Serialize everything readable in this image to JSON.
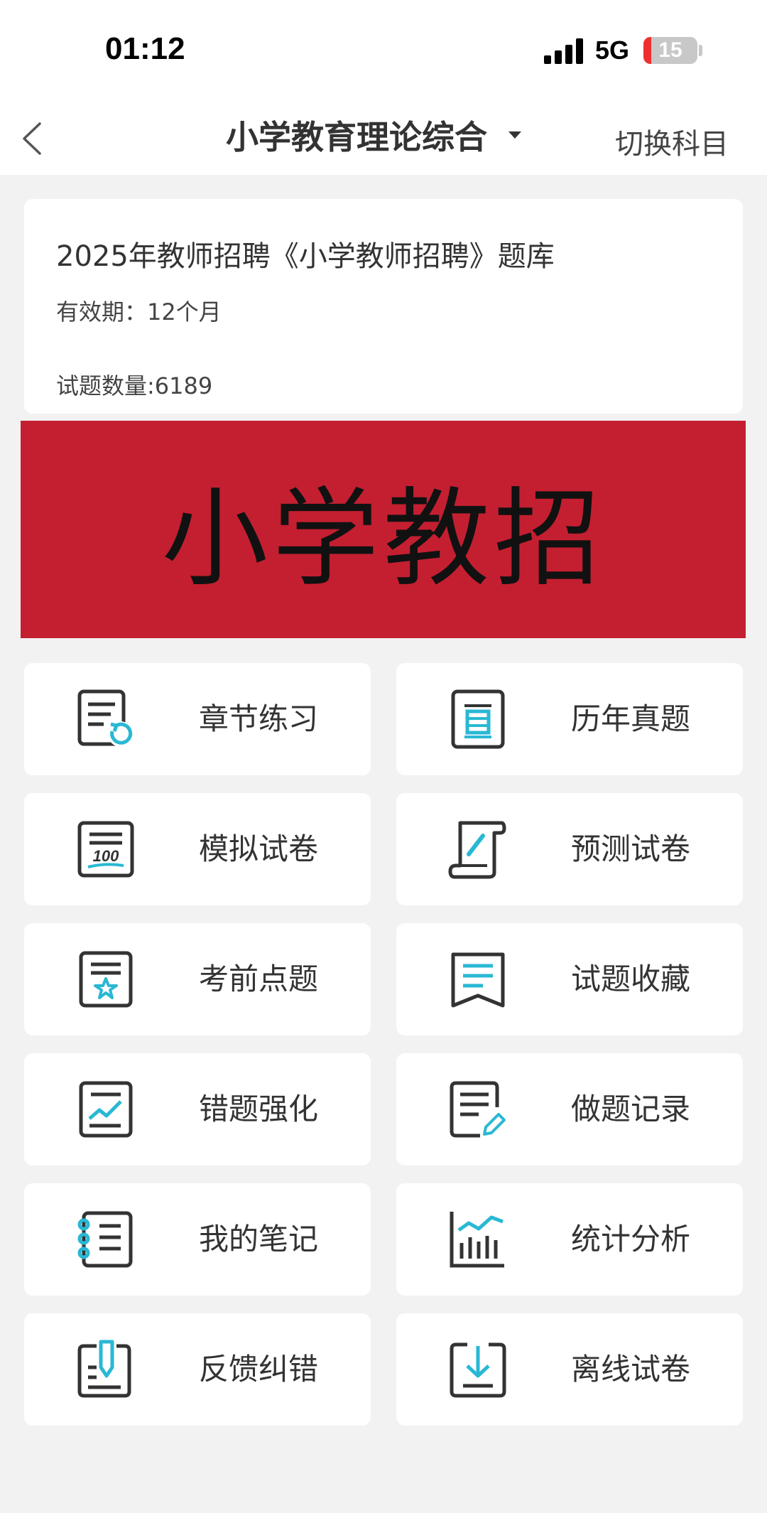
{
  "status_bar": {
    "time": "01:12",
    "network": "5G",
    "battery": "15",
    "battery_level_percent": 15
  },
  "nav": {
    "title": "小学教育理论综合",
    "switch_label": "切换科目"
  },
  "info_card": {
    "title": "2025年教师招聘《小学教师招聘》题库",
    "validity": "有效期：12个月",
    "question_count": "试题数量:6189"
  },
  "banner": {
    "text": "小学教招",
    "background": "#c41f31"
  },
  "accent_color": "#29b8d4",
  "menu": [
    {
      "label": "章节练习",
      "icon": "chapter-practice-icon"
    },
    {
      "label": "历年真题",
      "icon": "past-papers-icon"
    },
    {
      "label": "模拟试卷",
      "icon": "mock-exam-icon"
    },
    {
      "label": "预测试卷",
      "icon": "prediction-exam-icon"
    },
    {
      "label": "考前点题",
      "icon": "key-points-icon"
    },
    {
      "label": "试题收藏",
      "icon": "favorites-icon"
    },
    {
      "label": "错题强化",
      "icon": "wrong-questions-icon"
    },
    {
      "label": "做题记录",
      "icon": "practice-record-icon"
    },
    {
      "label": "我的笔记",
      "icon": "notes-icon"
    },
    {
      "label": "统计分析",
      "icon": "statistics-icon"
    },
    {
      "label": "反馈纠错",
      "icon": "feedback-icon"
    },
    {
      "label": "离线试卷",
      "icon": "offline-download-icon"
    }
  ]
}
